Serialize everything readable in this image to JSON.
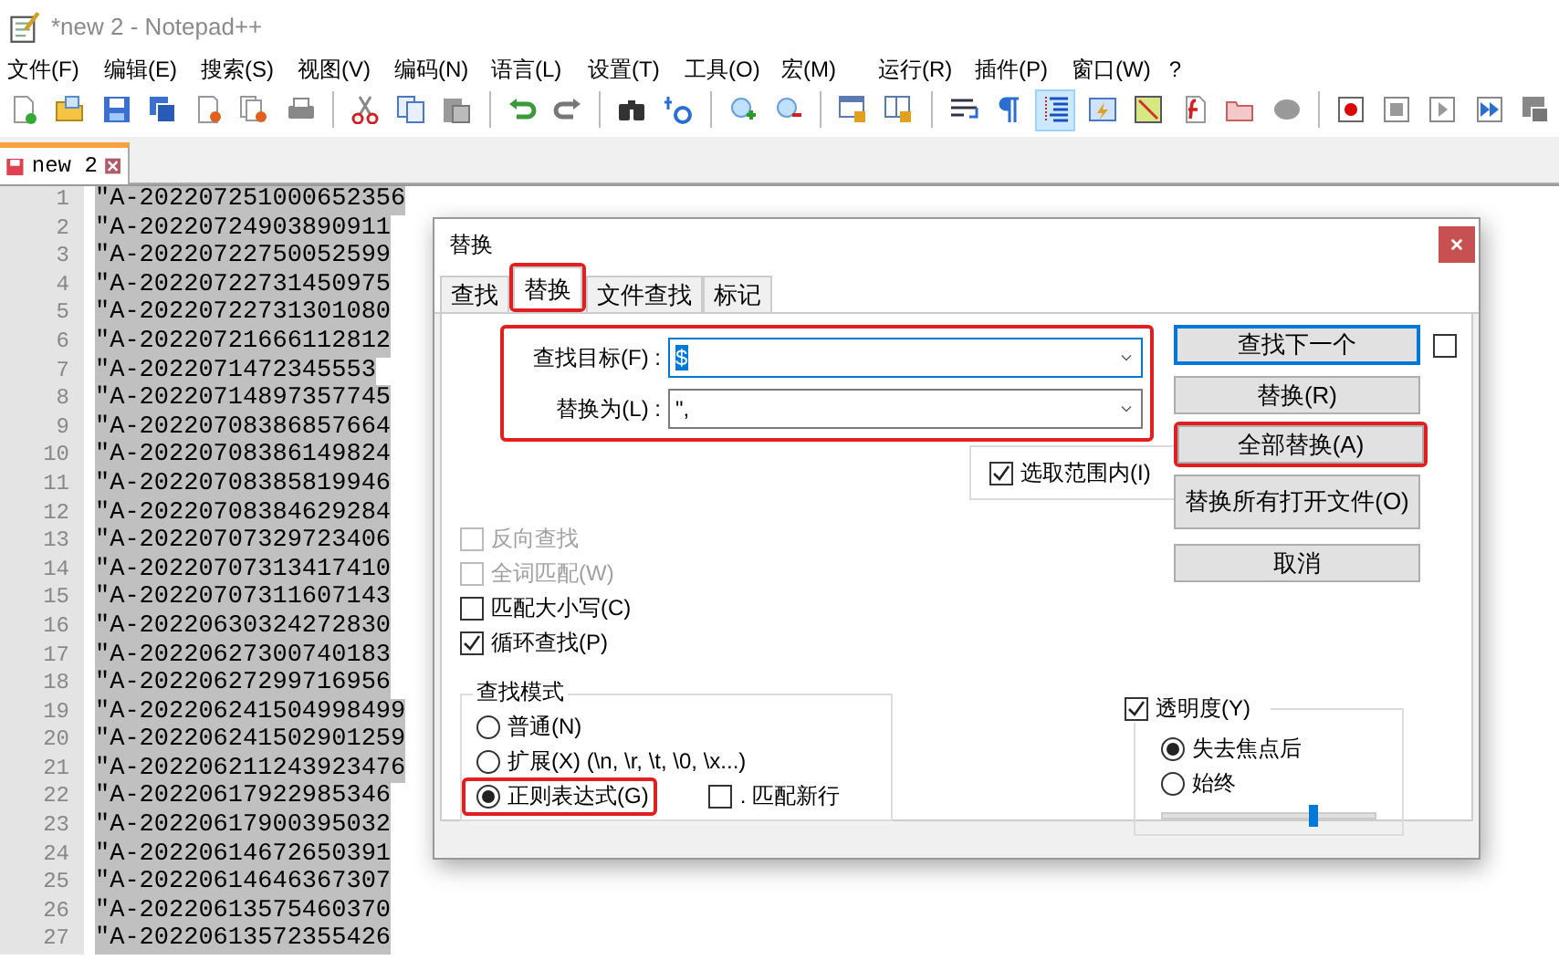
{
  "window": {
    "title": "*new 2 - Notepad++"
  },
  "menu": [
    "文件(F)",
    "编辑(E)",
    "搜索(S)",
    "视图(V)",
    "编码(N)",
    "语言(L)",
    "设置(T)",
    "工具(O)",
    "宏(M)",
    "运行(R)",
    "插件(P)",
    "窗口(W)",
    "?"
  ],
  "toolbar": [
    {
      "kind": "new",
      "selected": false
    },
    {
      "kind": "open",
      "selected": false
    },
    {
      "kind": "save",
      "selected": false
    },
    {
      "kind": "saveall",
      "selected": false
    },
    {
      "kind": "close",
      "selected": false
    },
    {
      "kind": "closeall",
      "selected": false
    },
    {
      "kind": "print",
      "selected": false
    },
    {
      "kind": "separator"
    },
    {
      "kind": "cut",
      "selected": false
    },
    {
      "kind": "copy",
      "selected": false
    },
    {
      "kind": "paste",
      "selected": false
    },
    {
      "kind": "separator"
    },
    {
      "kind": "undo",
      "selected": false
    },
    {
      "kind": "redo",
      "selected": false
    },
    {
      "kind": "separator"
    },
    {
      "kind": "find",
      "selected": false
    },
    {
      "kind": "replace",
      "selected": false
    },
    {
      "kind": "separator"
    },
    {
      "kind": "zoomin",
      "selected": false
    },
    {
      "kind": "zoomout",
      "selected": false
    },
    {
      "kind": "separator"
    },
    {
      "kind": "lockv",
      "selected": false
    },
    {
      "kind": "lockh",
      "selected": false
    },
    {
      "kind": "separator"
    },
    {
      "kind": "wrap",
      "selected": false
    },
    {
      "kind": "pilcrow",
      "selected": false
    },
    {
      "kind": "indent",
      "selected": true
    },
    {
      "kind": "lightning",
      "selected": false
    },
    {
      "kind": "map",
      "selected": false
    },
    {
      "kind": "function",
      "selected": false
    },
    {
      "kind": "folder",
      "selected": false
    },
    {
      "kind": "monitor",
      "selected": false
    },
    {
      "kind": "separator"
    },
    {
      "kind": "record",
      "selected": false
    },
    {
      "kind": "stop",
      "selected": false
    },
    {
      "kind": "play",
      "selected": false
    },
    {
      "kind": "playmulti",
      "selected": false
    },
    {
      "kind": "savemacro",
      "selected": false
    }
  ],
  "tabs": [
    {
      "label": "new 2",
      "modified": true,
      "selected": true
    }
  ],
  "editor": {
    "lines": [
      {
        "number": "1",
        "text": "\"A-202207251000652356",
        "selected": true
      },
      {
        "number": "2",
        "text": "\"A-20220724903890911",
        "selected": true
      },
      {
        "number": "3",
        "text": "\"A-20220722750052599",
        "selected": true
      },
      {
        "number": "4",
        "text": "\"A-20220722731450975",
        "selected": true
      },
      {
        "number": "5",
        "text": "\"A-20220722731301080",
        "selected": true
      },
      {
        "number": "6",
        "text": "\"A-20220721666112812",
        "selected": true
      },
      {
        "number": "7",
        "text": "\"A-2022071472345553",
        "selected": true
      },
      {
        "number": "8",
        "text": "\"A-20220714897357745",
        "selected": true
      },
      {
        "number": "9",
        "text": "\"A-20220708386857664",
        "selected": true
      },
      {
        "number": "10",
        "text": "\"A-20220708386149824",
        "selected": true
      },
      {
        "number": "11",
        "text": "\"A-20220708385819946",
        "selected": true
      },
      {
        "number": "12",
        "text": "\"A-20220708384629284",
        "selected": true
      },
      {
        "number": "13",
        "text": "\"A-20220707329723406",
        "selected": true
      },
      {
        "number": "14",
        "text": "\"A-20220707313417410",
        "selected": true
      },
      {
        "number": "15",
        "text": "\"A-20220707311607143",
        "selected": true
      },
      {
        "number": "16",
        "text": "\"A-20220630324272830",
        "selected": true
      },
      {
        "number": "17",
        "text": "\"A-20220627300740183",
        "selected": true
      },
      {
        "number": "18",
        "text": "\"A-20220627299716956",
        "selected": true
      },
      {
        "number": "19",
        "text": "\"A-202206241504998499",
        "selected": true
      },
      {
        "number": "20",
        "text": "\"A-202206241502901259",
        "selected": true
      },
      {
        "number": "21",
        "text": "\"A-202206211243923476",
        "selected": true
      },
      {
        "number": "22",
        "text": "\"A-20220617922985346",
        "selected": true
      },
      {
        "number": "23",
        "text": "\"A-20220617900395032",
        "selected": true
      },
      {
        "number": "24",
        "text": "\"A-20220614672650391",
        "selected": true
      },
      {
        "number": "25",
        "text": "\"A-20220614646367307",
        "selected": true
      },
      {
        "number": "26",
        "text": "\"A-20220613575460370",
        "selected": true
      },
      {
        "number": "27",
        "text": "\"A-20220613572355426",
        "selected": true
      }
    ]
  },
  "dialog": {
    "title": "替换",
    "tabs": [
      {
        "label": "查找",
        "selected": false,
        "highlighted": false
      },
      {
        "label": "替换",
        "selected": true,
        "highlighted": true
      },
      {
        "label": "文件查找",
        "selected": false,
        "highlighted": false
      },
      {
        "label": "标记",
        "selected": false,
        "highlighted": false
      }
    ],
    "fields": {
      "highlighted": true,
      "items": [
        {
          "label": "查找目标(F) :",
          "value": "$",
          "value_selected": true
        },
        {
          "label": "替换为(L) :",
          "value": "\",",
          "value_selected": false
        }
      ]
    },
    "in_selection": {
      "label": "选取范围内(I)",
      "checked": true
    },
    "options": [
      {
        "label": "反向查找",
        "checked": false,
        "disabled": true
      },
      {
        "label": "全词匹配(W)",
        "checked": false,
        "disabled": true
      },
      {
        "label": "匹配大小写(C)",
        "checked": false,
        "disabled": false
      },
      {
        "label": "循环查找(P)",
        "checked": true,
        "disabled": false
      }
    ],
    "buttons": [
      {
        "label": "查找下一个",
        "focused": true,
        "highlighted": false
      },
      {
        "label": "替换(R)",
        "focused": false,
        "highlighted": false
      },
      {
        "label": "全部替换(A)",
        "focused": false,
        "highlighted": true
      },
      {
        "label": "替换所有打开文件(O)",
        "focused": false,
        "highlighted": false
      },
      {
        "label": "取消",
        "focused": false,
        "highlighted": false
      }
    ],
    "find_next_option": {
      "checked": false
    },
    "search_mode": {
      "title": "查找模式",
      "options": [
        {
          "label": "普通(N)",
          "selected": false,
          "highlighted": false
        },
        {
          "label": "扩展(X) (\\n, \\r, \\t, \\0, \\x...)",
          "selected": false,
          "highlighted": false
        },
        {
          "label": "正则表达式(G)",
          "selected": true,
          "highlighted": true
        }
      ],
      "dot_newline": {
        "label": ". 匹配新行",
        "checked": false
      }
    },
    "transparency": {
      "label": "透明度(Y)",
      "checked": true,
      "options": [
        {
          "label": "失去焦点后",
          "selected": true
        },
        {
          "label": "始终",
          "selected": false
        }
      ],
      "level": 0.71
    }
  }
}
